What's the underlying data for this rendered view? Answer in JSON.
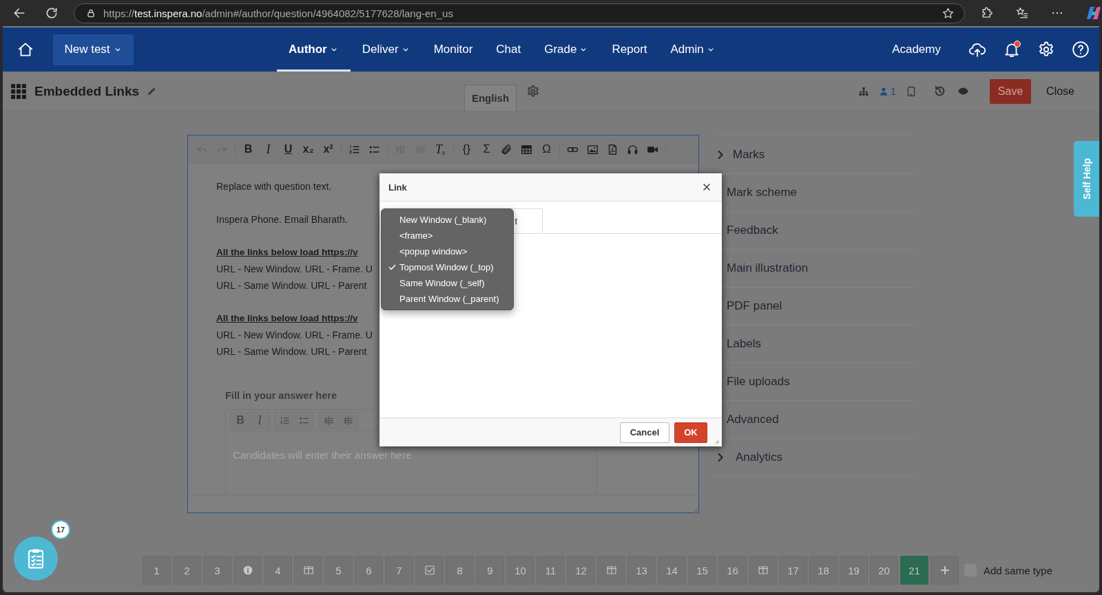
{
  "browser": {
    "scheme": "https://",
    "host": "test.inspera.no",
    "path": "/admin#/author/question/4964082/5177628/lang-en_us"
  },
  "nav": {
    "new_test": "New test",
    "items": [
      {
        "label": "Author",
        "has_menu": true,
        "selected": true
      },
      {
        "label": "Deliver",
        "has_menu": true,
        "selected": false
      },
      {
        "label": "Monitor",
        "has_menu": false,
        "selected": false
      },
      {
        "label": "Chat",
        "has_menu": false,
        "selected": false
      },
      {
        "label": "Grade",
        "has_menu": true,
        "selected": false
      },
      {
        "label": "Report",
        "has_menu": false,
        "selected": false
      },
      {
        "label": "Admin",
        "has_menu": true,
        "selected": false
      }
    ],
    "academy": "Academy",
    "notification_unread": true
  },
  "title_row": {
    "title": "Embedded Links",
    "language": "English",
    "user_count": "1",
    "save": "Save",
    "close": "Close"
  },
  "editor": {
    "toolbar": [
      "B",
      "I",
      "U",
      "x₂",
      "x²",
      "Tₓ",
      "{}",
      "Σ",
      "Ω"
    ],
    "paragraphs": [
      [
        {
          "text": "Replace with question text.",
          "kind": "plain"
        }
      ],
      [
        {
          "text": "Inspera Phone. Email Bharath.",
          "kind": "plain"
        }
      ],
      [
        {
          "text": "All the links below load https://v",
          "kind": "heading"
        },
        {
          "text": "URL - New Window. URL - Frame. U",
          "kind": "plain"
        },
        {
          "text": "URL - Same Window. URL - Parent",
          "kind": "plain"
        }
      ],
      [
        {
          "text": "All the links below load https://v",
          "kind": "heading"
        },
        {
          "text": "URL - New Window. URL - Frame. U",
          "kind": "plain"
        },
        {
          "text": "URL - Same Window. URL - Parent",
          "kind": "plain"
        }
      ]
    ],
    "answer": {
      "label": "Fill in your answer here",
      "toolbar": [
        "B",
        "I"
      ],
      "placeholder": "Candidates will enter their answer here"
    }
  },
  "side_menu": [
    {
      "label": "Marks",
      "expandable": true
    },
    {
      "label": "Mark scheme",
      "expandable": false
    },
    {
      "label": "Feedback",
      "expandable": false
    },
    {
      "label": "Main illustration",
      "expandable": false
    },
    {
      "label": "PDF panel",
      "expandable": false
    },
    {
      "label": "Labels",
      "expandable": false
    },
    {
      "label": "File uploads",
      "expandable": false
    },
    {
      "label": "Advanced",
      "expandable": false
    },
    {
      "label": "Analytics",
      "expandable": true
    }
  ],
  "pages": [
    {
      "kind": "number",
      "label": "1",
      "selected": false
    },
    {
      "kind": "number",
      "label": "2",
      "selected": false
    },
    {
      "kind": "number",
      "label": "3",
      "selected": false
    },
    {
      "kind": "info",
      "selected": false
    },
    {
      "kind": "number",
      "label": "4",
      "selected": false
    },
    {
      "kind": "split",
      "selected": false
    },
    {
      "kind": "number",
      "label": "5",
      "selected": false
    },
    {
      "kind": "number",
      "label": "6",
      "selected": false
    },
    {
      "kind": "number",
      "label": "7",
      "selected": false
    },
    {
      "kind": "check",
      "selected": false
    },
    {
      "kind": "number",
      "label": "8",
      "selected": false
    },
    {
      "kind": "number",
      "label": "9",
      "selected": false
    },
    {
      "kind": "number",
      "label": "10",
      "selected": false
    },
    {
      "kind": "number",
      "label": "11",
      "selected": false
    },
    {
      "kind": "number",
      "label": "12",
      "selected": false
    },
    {
      "kind": "split",
      "selected": false
    },
    {
      "kind": "number",
      "label": "13",
      "selected": false
    },
    {
      "kind": "number",
      "label": "14",
      "selected": false
    },
    {
      "kind": "number",
      "label": "15",
      "selected": false
    },
    {
      "kind": "number",
      "label": "16",
      "selected": false
    },
    {
      "kind": "split",
      "selected": false
    },
    {
      "kind": "number",
      "label": "17",
      "selected": false
    },
    {
      "kind": "number",
      "label": "18",
      "selected": false
    },
    {
      "kind": "number",
      "label": "19",
      "selected": false
    },
    {
      "kind": "number",
      "label": "20",
      "selected": false
    },
    {
      "kind": "number",
      "label": "21",
      "selected": true
    },
    {
      "kind": "add",
      "selected": false
    }
  ],
  "add_same_type": {
    "label": "Add same type",
    "checked": false
  },
  "dialog": {
    "title": "Link",
    "tab_label": "t",
    "cancel": "Cancel",
    "ok": "OK",
    "target_menu": [
      {
        "label": "New Window (_blank)",
        "checked": false
      },
      {
        "label": "<frame>",
        "checked": false
      },
      {
        "label": "<popup window>",
        "checked": false
      },
      {
        "label": "Topmost Window (_top)",
        "checked": true
      },
      {
        "label": "Same Window (_self)",
        "checked": false
      },
      {
        "label": "Parent Window (_parent)",
        "checked": false
      }
    ]
  },
  "self_help": "Self Help",
  "overview_badge": "17"
}
